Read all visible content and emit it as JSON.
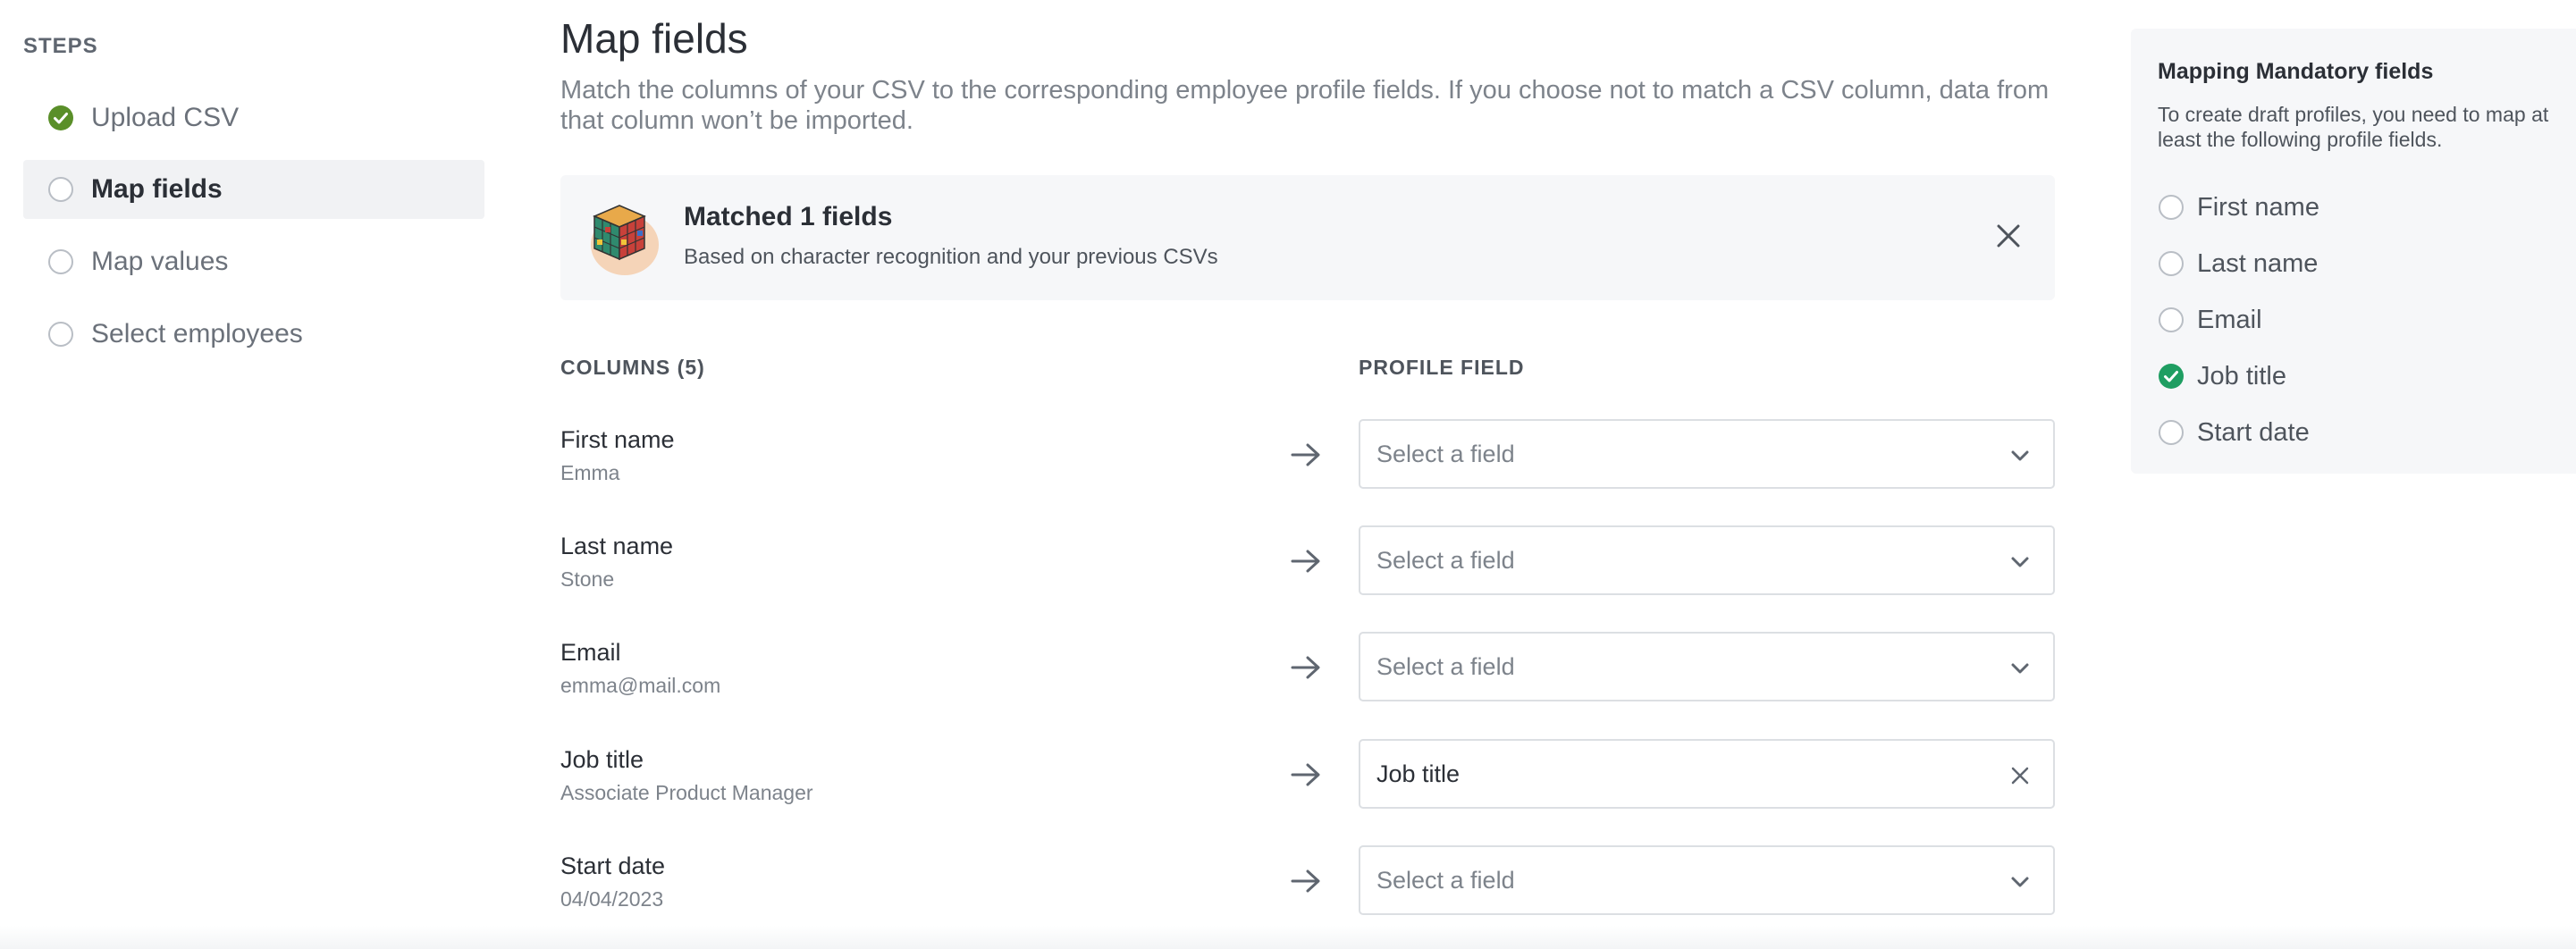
{
  "steps": {
    "title": "STEPS",
    "items": [
      {
        "label": "Upload CSV",
        "status": "done"
      },
      {
        "label": "Map fields",
        "status": "current"
      },
      {
        "label": "Map values",
        "status": "pending"
      },
      {
        "label": "Select employees",
        "status": "pending"
      }
    ]
  },
  "main": {
    "title": "Map fields",
    "description": "Match the columns of your CSV to the corresponding employee profile fields. If you choose not to match a CSV column, data from that column won’t be imported."
  },
  "banner": {
    "title": "Matched 1 fields",
    "subtitle": "Based on character recognition and your previous CSVs",
    "illustration_icon": "rubiks-cube-icon",
    "close_icon": "close-icon"
  },
  "table": {
    "columns_header": "COLUMNS (5)",
    "profile_header": "PROFILE FIELD",
    "rows": [
      {
        "name": "First name",
        "sample": "Emma",
        "field": "Select a field",
        "mapped": false
      },
      {
        "name": "Last name",
        "sample": "Stone",
        "field": "Select a field",
        "mapped": false
      },
      {
        "name": "Email",
        "sample": "emma@mail.com",
        "field": "Select a field",
        "mapped": false
      },
      {
        "name": "Job title",
        "sample": "Associate Product Manager",
        "field": "Job title",
        "mapped": true
      },
      {
        "name": "Start date",
        "sample": "04/04/2023",
        "field": "Select a field",
        "mapped": false
      }
    ]
  },
  "side_panel": {
    "title": "Mapping Mandatory fields",
    "description": "To create draft profiles, you need to map at least the following profile fields.",
    "items": [
      {
        "label": "First name",
        "checked": false
      },
      {
        "label": "Last name",
        "checked": false
      },
      {
        "label": "Email",
        "checked": false
      },
      {
        "label": "Job title",
        "checked": true
      },
      {
        "label": "Start date",
        "checked": false
      }
    ]
  },
  "colors": {
    "done_step": "#5a8f29",
    "checked_required": "#1f9e62",
    "muted_text": "#7d838b",
    "panel_bg": "#f6f7f9"
  }
}
